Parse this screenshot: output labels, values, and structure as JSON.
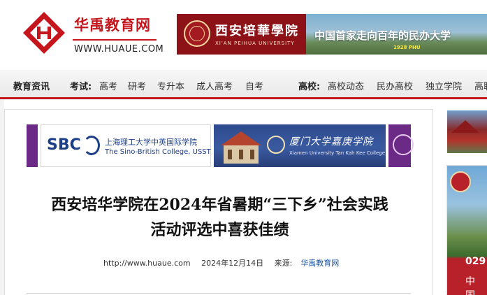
{
  "site": {
    "name": "华禹教育网",
    "url": "WWW.HUAUE.COM"
  },
  "header_ad": {
    "school_name": "西安培華學院",
    "school_en": "XI'AN PEIHUA UNIVERSITY",
    "slogan": "中国首家走向百年的民办大学",
    "tag": "1928 PHU"
  },
  "nav": {
    "info": "教育资讯",
    "exam_label": "考试:",
    "exam_items": [
      "高考",
      "研考",
      "专升本",
      "成人高考",
      "自考"
    ],
    "school_label": "高校:",
    "school_items": [
      "高校动态",
      "民办高校",
      "独立学院",
      "高职"
    ]
  },
  "banners": {
    "sbc_logo": "SBC",
    "sbc_cn": "上海理工大学中英国际学院",
    "sbc_en": "The Sino-British College, USST",
    "xmu_cn": "厦门大学嘉庚学院",
    "xmu_en": "Xiamen University Tan Kah Kee College"
  },
  "article": {
    "title_line1": "西安培华学院在2024年省暑期“三下乡”社会实践",
    "title_line2": "活动评选中喜获佳绩",
    "source_url": "http://www.huaue.com",
    "date": "2024年12月14日",
    "source_label": "来源:",
    "source_name": "华禹教育网"
  },
  "sidebar": {
    "phone_prefix": "029",
    "cn_text": "中 国"
  },
  "colors": {
    "brand_red": "#c4161c",
    "link_blue": "#1a55a6"
  }
}
